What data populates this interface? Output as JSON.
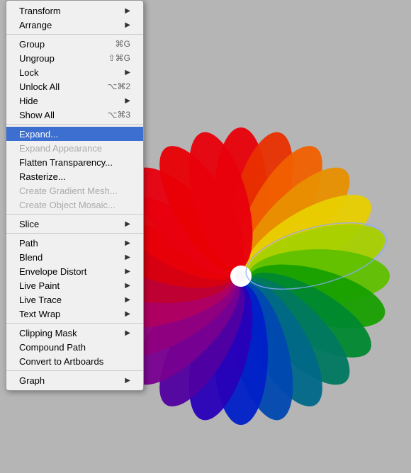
{
  "background_color": "#b0b0b0",
  "menu": {
    "items": [
      {
        "id": "transform",
        "label": "Transform",
        "shortcut": "",
        "has_arrow": true,
        "state": "normal",
        "type": "item"
      },
      {
        "id": "arrange",
        "label": "Arrange",
        "shortcut": "",
        "has_arrow": true,
        "state": "normal",
        "type": "item"
      },
      {
        "type": "separator"
      },
      {
        "id": "group",
        "label": "Group",
        "shortcut": "⌘G",
        "has_arrow": false,
        "state": "normal",
        "type": "item"
      },
      {
        "id": "ungroup",
        "label": "Ungroup",
        "shortcut": "⇧⌘G",
        "has_arrow": false,
        "state": "normal",
        "type": "item"
      },
      {
        "id": "lock",
        "label": "Lock",
        "shortcut": "",
        "has_arrow": true,
        "state": "normal",
        "type": "item"
      },
      {
        "id": "unlock-all",
        "label": "Unlock All",
        "shortcut": "⌥⌘2",
        "has_arrow": false,
        "state": "normal",
        "type": "item"
      },
      {
        "id": "hide",
        "label": "Hide",
        "shortcut": "",
        "has_arrow": true,
        "state": "normal",
        "type": "item"
      },
      {
        "id": "show-all",
        "label": "Show All",
        "shortcut": "⌥⌘3",
        "has_arrow": false,
        "state": "normal",
        "type": "item"
      },
      {
        "type": "separator"
      },
      {
        "id": "expand",
        "label": "Expand...",
        "shortcut": "",
        "has_arrow": false,
        "state": "selected",
        "type": "item"
      },
      {
        "id": "expand-appearance",
        "label": "Expand Appearance",
        "shortcut": "",
        "has_arrow": false,
        "state": "disabled",
        "type": "item"
      },
      {
        "id": "flatten-transparency",
        "label": "Flatten Transparency...",
        "shortcut": "",
        "has_arrow": false,
        "state": "normal",
        "type": "item"
      },
      {
        "id": "rasterize",
        "label": "Rasterize...",
        "shortcut": "",
        "has_arrow": false,
        "state": "normal",
        "type": "item"
      },
      {
        "id": "create-gradient-mesh",
        "label": "Create Gradient Mesh...",
        "shortcut": "",
        "has_arrow": false,
        "state": "disabled",
        "type": "item"
      },
      {
        "id": "create-object-mosaic",
        "label": "Create Object Mosaic...",
        "shortcut": "",
        "has_arrow": false,
        "state": "disabled",
        "type": "item"
      },
      {
        "type": "separator"
      },
      {
        "id": "slice",
        "label": "Slice",
        "shortcut": "",
        "has_arrow": true,
        "state": "normal",
        "type": "item"
      },
      {
        "type": "separator"
      },
      {
        "id": "path",
        "label": "Path",
        "shortcut": "",
        "has_arrow": true,
        "state": "normal",
        "type": "item"
      },
      {
        "id": "blend",
        "label": "Blend",
        "shortcut": "",
        "has_arrow": true,
        "state": "normal",
        "type": "item"
      },
      {
        "id": "envelope-distort",
        "label": "Envelope Distort",
        "shortcut": "",
        "has_arrow": true,
        "state": "normal",
        "type": "item"
      },
      {
        "id": "live-paint",
        "label": "Live Paint",
        "shortcut": "",
        "has_arrow": true,
        "state": "normal",
        "type": "item"
      },
      {
        "id": "live-trace",
        "label": "Live Trace",
        "shortcut": "",
        "has_arrow": true,
        "state": "normal",
        "type": "item"
      },
      {
        "id": "text-wrap",
        "label": "Text Wrap",
        "shortcut": "",
        "has_arrow": true,
        "state": "normal",
        "type": "item"
      },
      {
        "type": "separator"
      },
      {
        "id": "clipping-mask",
        "label": "Clipping Mask",
        "shortcut": "",
        "has_arrow": true,
        "state": "normal",
        "type": "item"
      },
      {
        "id": "compound-path",
        "label": "Compound Path",
        "shortcut": "",
        "has_arrow": false,
        "state": "normal",
        "type": "item"
      },
      {
        "id": "convert-to-artboards",
        "label": "Convert to Artboards",
        "shortcut": "",
        "has_arrow": false,
        "state": "normal",
        "type": "item"
      },
      {
        "type": "separator"
      },
      {
        "id": "graph",
        "label": "Graph",
        "shortcut": "",
        "has_arrow": true,
        "state": "normal",
        "type": "item"
      }
    ]
  }
}
